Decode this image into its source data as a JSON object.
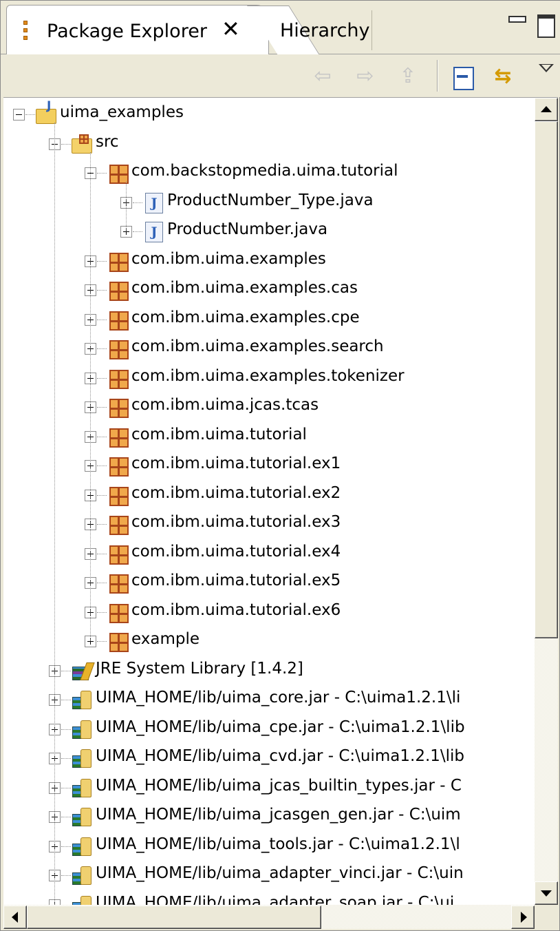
{
  "tabs": [
    {
      "label": "Package Explorer",
      "active": true
    },
    {
      "label": "Hierarchy",
      "active": false
    }
  ],
  "toolbar": {
    "back": "⇦",
    "forward": "⇨",
    "up": "⇪",
    "link": "⇆"
  },
  "tree": [
    {
      "label": "uima_examples",
      "icon": "project-icon",
      "depth": 0,
      "state": "expanded"
    },
    {
      "label": "src",
      "icon": "src-icon",
      "depth": 1,
      "state": "expanded"
    },
    {
      "label": "com.backstopmedia.uima.tutorial",
      "icon": "package-icon",
      "depth": 2,
      "state": "expanded"
    },
    {
      "label": "ProductNumber_Type.java",
      "icon": "java-icon",
      "depth": 3,
      "state": "collapsed"
    },
    {
      "label": "ProductNumber.java",
      "icon": "java-icon",
      "depth": 3,
      "state": "collapsed"
    },
    {
      "label": "com.ibm.uima.examples",
      "icon": "package-icon",
      "depth": 2,
      "state": "collapsed"
    },
    {
      "label": "com.ibm.uima.examples.cas",
      "icon": "package-icon",
      "depth": 2,
      "state": "collapsed"
    },
    {
      "label": "com.ibm.uima.examples.cpe",
      "icon": "package-icon",
      "depth": 2,
      "state": "collapsed"
    },
    {
      "label": "com.ibm.uima.examples.search",
      "icon": "package-icon",
      "depth": 2,
      "state": "collapsed"
    },
    {
      "label": "com.ibm.uima.examples.tokenizer",
      "icon": "package-icon",
      "depth": 2,
      "state": "collapsed"
    },
    {
      "label": "com.ibm.uima.jcas.tcas",
      "icon": "package-icon",
      "depth": 2,
      "state": "collapsed"
    },
    {
      "label": "com.ibm.uima.tutorial",
      "icon": "package-icon",
      "depth": 2,
      "state": "collapsed"
    },
    {
      "label": "com.ibm.uima.tutorial.ex1",
      "icon": "package-icon",
      "depth": 2,
      "state": "collapsed"
    },
    {
      "label": "com.ibm.uima.tutorial.ex2",
      "icon": "package-icon",
      "depth": 2,
      "state": "collapsed"
    },
    {
      "label": "com.ibm.uima.tutorial.ex3",
      "icon": "package-icon",
      "depth": 2,
      "state": "collapsed"
    },
    {
      "label": "com.ibm.uima.tutorial.ex4",
      "icon": "package-icon",
      "depth": 2,
      "state": "collapsed"
    },
    {
      "label": "com.ibm.uima.tutorial.ex5",
      "icon": "package-icon",
      "depth": 2,
      "state": "collapsed"
    },
    {
      "label": "com.ibm.uima.tutorial.ex6",
      "icon": "package-icon",
      "depth": 2,
      "state": "collapsed"
    },
    {
      "label": "example",
      "icon": "package-icon",
      "depth": 2,
      "state": "collapsed"
    },
    {
      "label": "JRE System Library [1.4.2]",
      "icon": "library-icon",
      "depth": 1,
      "state": "collapsed"
    },
    {
      "label": "UIMA_HOME/lib/uima_core.jar - C:\\uima1.2.1\\li",
      "icon": "jar-icon",
      "depth": 1,
      "state": "collapsed"
    },
    {
      "label": "UIMA_HOME/lib/uima_cpe.jar - C:\\uima1.2.1\\lib",
      "icon": "jar-icon",
      "depth": 1,
      "state": "collapsed"
    },
    {
      "label": "UIMA_HOME/lib/uima_cvd.jar - C:\\uima1.2.1\\lib",
      "icon": "jar-icon",
      "depth": 1,
      "state": "collapsed"
    },
    {
      "label": "UIMA_HOME/lib/uima_jcas_builtin_types.jar - C",
      "icon": "jar-icon",
      "depth": 1,
      "state": "collapsed"
    },
    {
      "label": "UIMA_HOME/lib/uima_jcasgen_gen.jar - C:\\uim",
      "icon": "jar-icon",
      "depth": 1,
      "state": "collapsed"
    },
    {
      "label": "UIMA_HOME/lib/uima_tools.jar - C:\\uima1.2.1\\l",
      "icon": "jar-icon",
      "depth": 1,
      "state": "collapsed"
    },
    {
      "label": "UIMA_HOME/lib/uima_adapter_vinci.jar - C:\\uin",
      "icon": "jar-icon",
      "depth": 1,
      "state": "collapsed"
    },
    {
      "label": "UIMA_HOME/lib/uima_adapter_soap.jar - C:\\ui",
      "icon": "jar-icon",
      "depth": 1,
      "state": "collapsed"
    }
  ],
  "scroll": {
    "vertical_position": 0.0,
    "vertical_visible_fraction": 0.68,
    "horizontal_position": 0.0,
    "horizontal_visible_fraction": 0.58
  }
}
